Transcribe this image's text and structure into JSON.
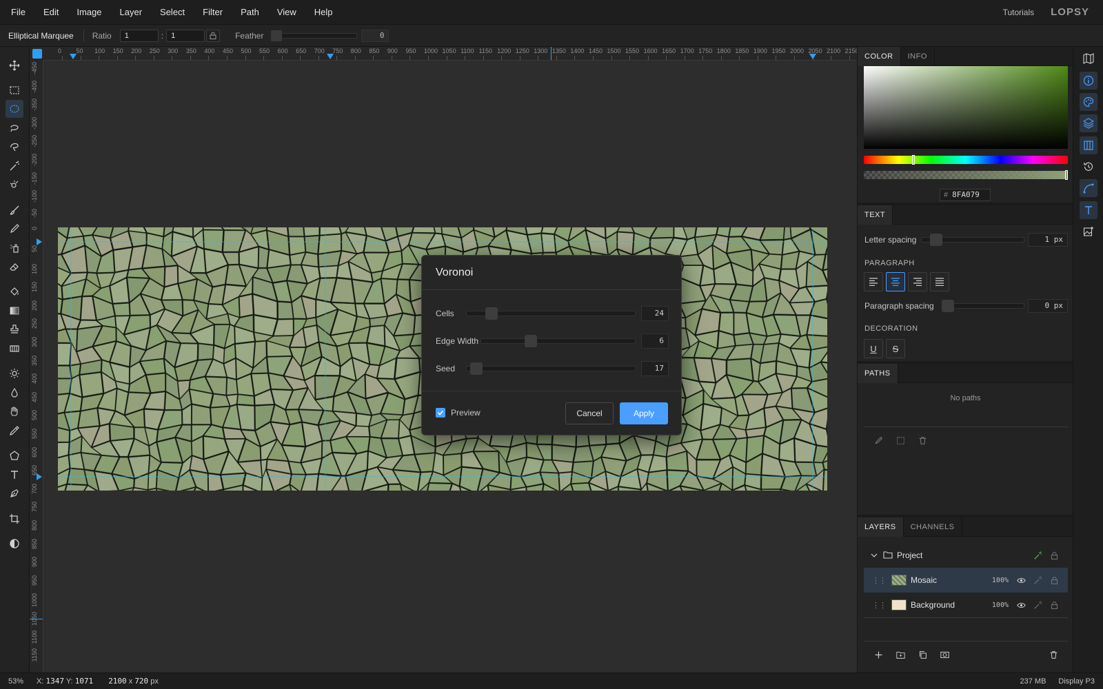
{
  "menu": {
    "items": [
      "File",
      "Edit",
      "Image",
      "Layer",
      "Select",
      "Filter",
      "Path",
      "View",
      "Help"
    ],
    "tutorials": "Tutorials",
    "logo": "LOPSY"
  },
  "options": {
    "tool_name": "Elliptical Marquee",
    "ratio_label": "Ratio",
    "ratio_w": "1",
    "ratio_sep": ":",
    "ratio_h": "1",
    "feather_label": "Feather",
    "feather_value": "0"
  },
  "ruler": {
    "top_labels": [
      "0",
      "50",
      "100",
      "150",
      "200",
      "250",
      "300",
      "350",
      "400",
      "450",
      "500",
      "550",
      "600",
      "650",
      "700",
      "750",
      "800",
      "850",
      "900",
      "950",
      "1000",
      "1050",
      "1100",
      "1150",
      "1200",
      "1250",
      "1300",
      "1350",
      "1400",
      "1450",
      "1500",
      "1550",
      "1600",
      "1650",
      "1700",
      "1750",
      "1800",
      "1850",
      "1900",
      "1950",
      "2000",
      "2050",
      "2100",
      "2150"
    ],
    "left_labels": [
      "-450",
      "-400",
      "-350",
      "-300",
      "-250",
      "-200",
      "-150",
      "-100",
      "-50",
      "0",
      "50",
      "100",
      "150",
      "200",
      "250",
      "300",
      "350",
      "400",
      "450",
      "500",
      "550",
      "600",
      "650",
      "700",
      "750",
      "800",
      "850",
      "900",
      "950",
      "1000",
      "1050",
      "1100",
      "1150"
    ]
  },
  "dialog": {
    "title": "Voronoi",
    "params": [
      {
        "label": "Cells",
        "value": "24"
      },
      {
        "label": "Edge Width",
        "value": "6"
      },
      {
        "label": "Seed",
        "value": "17"
      }
    ],
    "preview_label": "Preview",
    "preview_checked": true,
    "cancel_label": "Cancel",
    "apply_label": "Apply"
  },
  "color_panel": {
    "tabs": [
      "COLOR",
      "INFO"
    ],
    "hex_prefix": "#",
    "hex": "8FA079"
  },
  "text_panel": {
    "tab": "TEXT",
    "letter_spacing_label": "Letter spacing",
    "letter_spacing_value": "1 px",
    "paragraph_head": "PARAGRAPH",
    "paragraph_spacing_label": "Paragraph spacing",
    "paragraph_spacing_value": "0 px",
    "decoration_head": "DECORATION",
    "underline_glyph": "U",
    "strike_glyph": "S"
  },
  "paths_panel": {
    "tab": "PATHS",
    "empty_text": "No paths"
  },
  "layers_panel": {
    "tabs": [
      "LAYERS",
      "CHANNELS"
    ],
    "group": {
      "name": "Project"
    },
    "layers": [
      {
        "name": "Mosaic",
        "opacity": "100%"
      },
      {
        "name": "Background",
        "opacity": "100%"
      }
    ]
  },
  "status": {
    "zoom": "53%",
    "x_label": "X:",
    "x_value": "1347",
    "y_label": "Y:",
    "y_value": "1071",
    "dims_w": "2100",
    "dims_x": "x",
    "dims_h": "720",
    "dims_unit": "px",
    "memory": "237 MB",
    "color_profile": "Display P3"
  },
  "colors": {
    "accent": "#4a9eff",
    "ruler_accent": "#2ea0f0",
    "foreground": "#8FA079"
  }
}
